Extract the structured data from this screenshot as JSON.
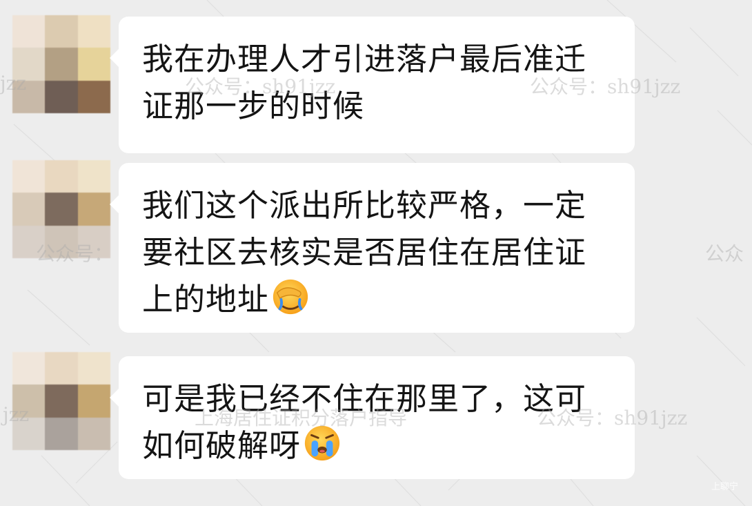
{
  "messages": [
    {
      "text": "我在办理人才引进落户最后准迁证那一步的时候",
      "emoji": null,
      "avatar_colors": [
        "#efe3d7",
        "#dccbb0",
        "#efe0c3",
        "#e2d8c8",
        "#b3a084",
        "#e6d39a",
        "#c8b9a8",
        "#6f5e55",
        "#8c6a4d"
      ]
    },
    {
      "text": "我们这个派出所比较严格，一定要社区去核实是否居住在居住证上的地址",
      "emoji": "facepalm-crying-emoji",
      "avatar_colors": [
        "#f0e4d7",
        "#e9d8c0",
        "#efe3c9",
        "#d8cab8",
        "#7d6b5e",
        "#c6a878",
        "#d9d0c8",
        "#cfc4b8",
        "#d8cec5"
      ]
    },
    {
      "text": "可是我已经不住在那里了，这可如何破解呀",
      "emoji": "crying-emoji",
      "avatar_colors": [
        "#f0e6db",
        "#e8d8c2",
        "#efe3cc",
        "#cdbfaa",
        "#7e6a5c",
        "#c5a670",
        "#d9d3cc",
        "#aaa29c",
        "#c9bdb0"
      ]
    }
  ],
  "watermarks": {
    "account": "公众号：sh91jzz",
    "account_partial_1": "jzz",
    "account_partial_2": "公众号：",
    "account_partial_3": "公众",
    "brand": "上海居住证积分落户指导",
    "corner": "上聊宁"
  }
}
